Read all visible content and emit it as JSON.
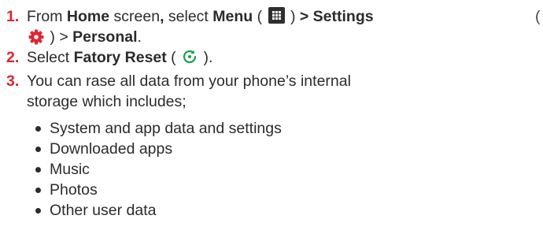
{
  "steps": [
    {
      "number": "1.",
      "pre_home": "From ",
      "home": "Home",
      "mid": " screen",
      "comma": ",",
      "select": " select ",
      "menu": "Menu",
      "menu_open": " ( ",
      "menu_close": " ) ",
      "settings": "> Settings",
      "gear_open": "(",
      "gear_close": " ) > ",
      "personal": "Personal",
      "end": ".",
      "icons": [
        "menu-grid-icon",
        "settings-gear-icon"
      ]
    },
    {
      "number": "2.",
      "pre": "Select ",
      "reset": "Fatory Reset",
      "icon_open": " ( ",
      "icon_close": " ).",
      "icons": [
        "factory-reset-icon"
      ]
    },
    {
      "number": "3.",
      "line1": "You can rase all data from your phone’s internal",
      "line2": "storage which includes;"
    }
  ],
  "bullets": [
    "System and app data and settings",
    "Downloaded apps",
    "Music",
    "Photos",
    "Other user data"
  ],
  "colors": {
    "step_number": "#d9262e",
    "gear_icon": "#e0262f",
    "reset_icon": "#16a04c",
    "menu_icon": "#2f2f2f"
  }
}
